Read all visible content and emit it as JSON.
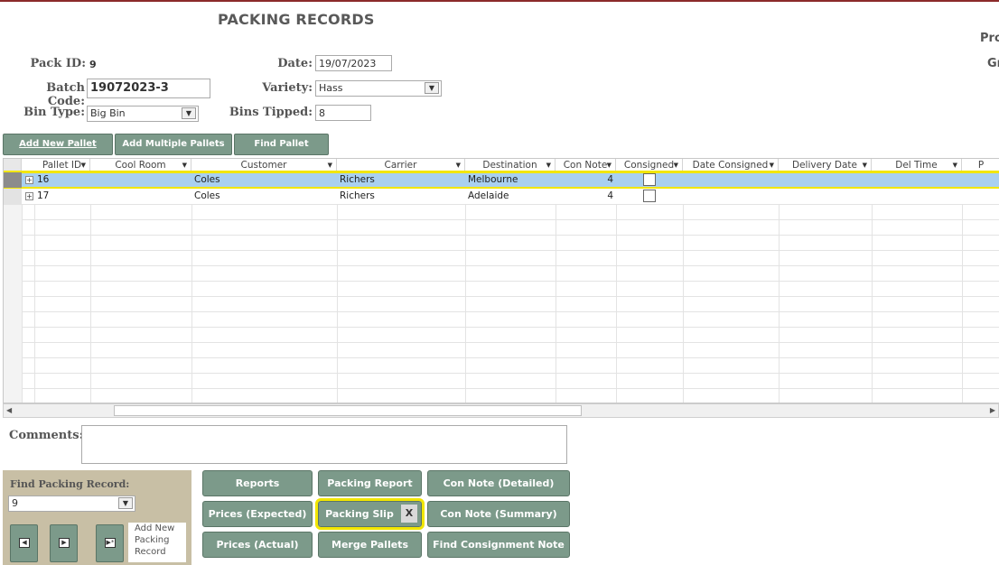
{
  "form": {
    "title": "PACKING RECORDS",
    "edge_labels": [
      "Pro",
      "Gr"
    ]
  },
  "fields": {
    "pack_id_label": "Pack ID:",
    "pack_id_value": "9",
    "date_label": "Date:",
    "date_value": "19/07/2023",
    "batch_code_label": "Batch Code:",
    "batch_code_value": "19072023-3",
    "variety_label": "Variety:",
    "variety_value": "Hass",
    "bin_type_label": "Bin Type:",
    "bin_type_value": "Big Bin",
    "bins_tipped_label": "Bins Tipped:",
    "bins_tipped_value": "8"
  },
  "toolbar": {
    "add_new_pallet": "Add New Pallet",
    "add_multiple_pallets": "Add Multiple Pallets",
    "find_pallet": "Find Pallet"
  },
  "grid": {
    "columns": [
      "Pallet ID",
      "Cool Room",
      "Customer",
      "Carrier",
      "Destination",
      "Con Note",
      "Consigned",
      "Date Consigned",
      "Delivery Date",
      "Del Time",
      "P"
    ],
    "rows": [
      {
        "pallet_id": "16",
        "cool_room": "",
        "customer": "Coles",
        "carrier": "Richers",
        "destination": "Melbourne",
        "con_note": "4",
        "consigned": false,
        "selected": true
      },
      {
        "pallet_id": "17",
        "cool_room": "",
        "customer": "Coles",
        "carrier": "Richers",
        "destination": "Adelaide",
        "con_note": "4",
        "consigned": false,
        "selected": false
      }
    ]
  },
  "comments": {
    "label": "Comments:",
    "value": ""
  },
  "find_record": {
    "label": "Find Packing Record:",
    "value": "9",
    "add_new_label": "Add New Packing Record"
  },
  "actions": {
    "reports": "Reports",
    "packing_report": "Packing Report",
    "con_note_detailed": "Con Note (Detailed)",
    "prices_expected": "Prices (Expected)",
    "packing_slip": "Packing Slip",
    "packing_slip_close": "X",
    "con_note_summary": "Con Note (Summary)",
    "prices_actual": "Prices (Actual)",
    "merge_pallets": "Merge Pallets",
    "find_consignment_note": "Find Consignment Note"
  },
  "colors": {
    "button_green": "#7c9a8a",
    "highlight_yellow": "#f2e600",
    "selected_row": "#a9d0f0",
    "panel_tan": "#c8bfa5"
  }
}
